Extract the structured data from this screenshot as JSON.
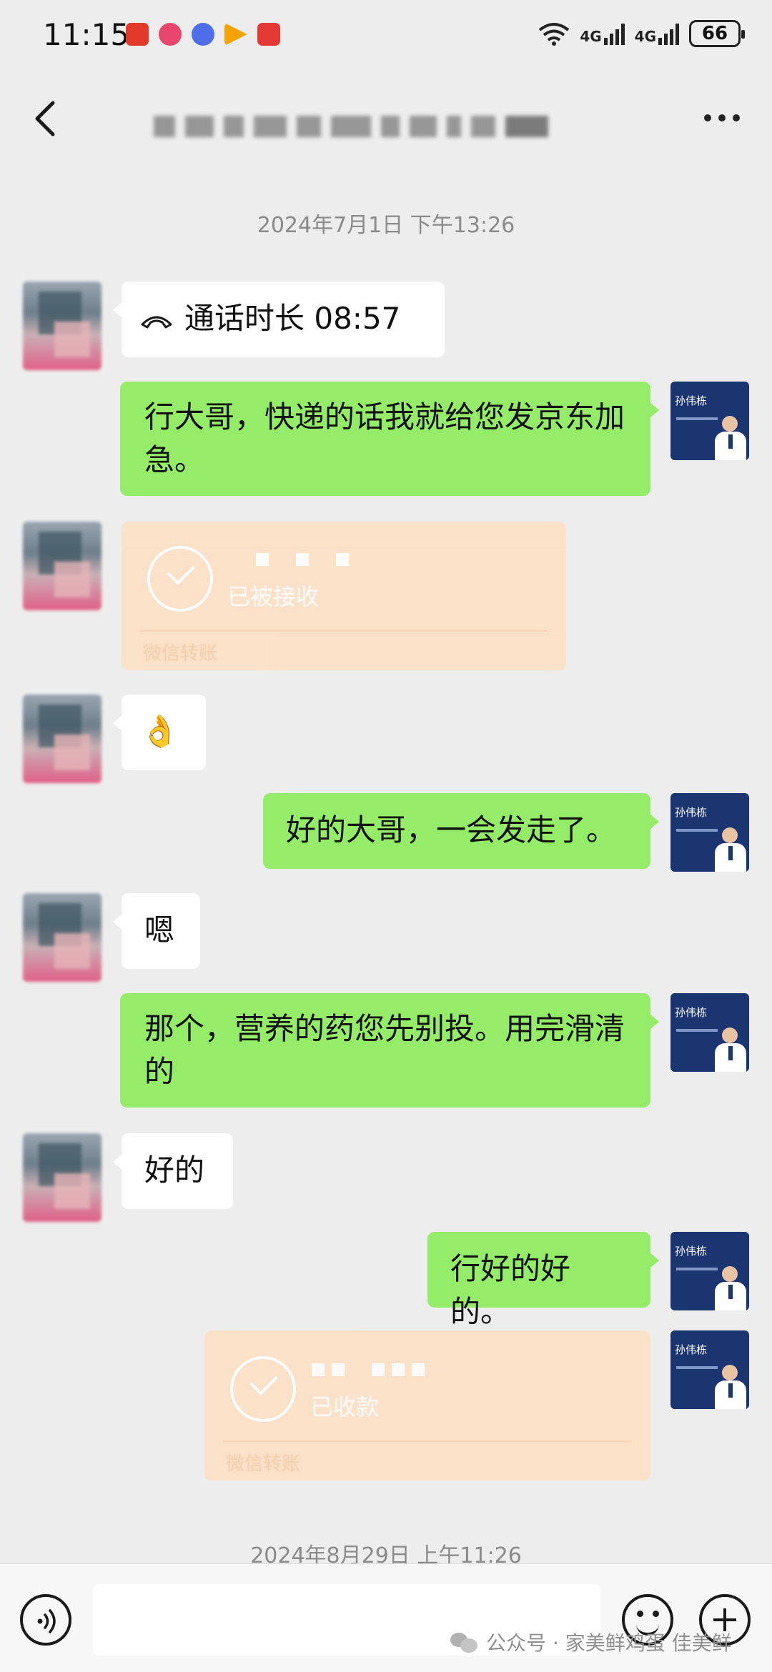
{
  "status_bar": {
    "time": "11:15",
    "network": [
      "4G",
      "4G"
    ],
    "battery": "66",
    "app_icon_colors": [
      "#e2382a",
      "#e8456f",
      "#4d6ee8",
      "#f5a300",
      "#e53935"
    ]
  },
  "header": {
    "title": "",
    "back_icon": "chevron-left-icon",
    "more_icon": "more-dots-icon"
  },
  "messages": {
    "timestamp_1": "2024年7月1日 下午13:26",
    "call": {
      "label": "通话时长 08:57",
      "icon": "phone-hangup-icon"
    },
    "m1": "行大哥，快递的话我就给您发京东加急。",
    "transfer_1": {
      "status": "已被接收",
      "source": "微信转账"
    },
    "emoji_ok": "👌",
    "m2": "好的大哥，一会发走了。",
    "m3": "嗯",
    "m4": "那个，营养的药您先别投。用完滑清的",
    "m5": "好的",
    "m6": "行好的好的。",
    "transfer_2": {
      "status": "已收款",
      "source": "微信转账"
    },
    "timestamp_2": "2024年8月29日 上午11:26"
  },
  "avatar_right": {
    "name": "孙伟栋"
  },
  "input_bar": {
    "input_value": "",
    "voice_icon": "voice-icon",
    "emoji_icon": "emoji-icon",
    "plus_icon": "plus-icon"
  },
  "watermark": {
    "text": "公众号 · 家美鲜鸡蛋 佳美鲜"
  },
  "colors": {
    "background": "#ededed",
    "bubble_sent": "#95ec69",
    "bubble_received": "#ffffff",
    "transfer_card": "#fddfc2"
  }
}
